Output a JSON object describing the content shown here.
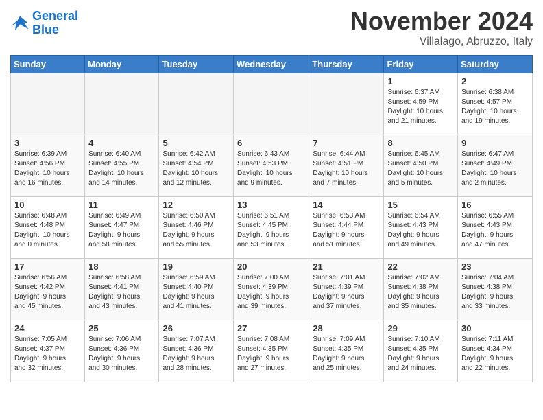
{
  "header": {
    "logo_line1": "General",
    "logo_line2": "Blue",
    "month": "November 2024",
    "location": "Villalago, Abruzzo, Italy"
  },
  "weekdays": [
    "Sunday",
    "Monday",
    "Tuesday",
    "Wednesday",
    "Thursday",
    "Friday",
    "Saturday"
  ],
  "weeks": [
    [
      {
        "day": "",
        "info": ""
      },
      {
        "day": "",
        "info": ""
      },
      {
        "day": "",
        "info": ""
      },
      {
        "day": "",
        "info": ""
      },
      {
        "day": "",
        "info": ""
      },
      {
        "day": "1",
        "info": "Sunrise: 6:37 AM\nSunset: 4:59 PM\nDaylight: 10 hours\nand 21 minutes."
      },
      {
        "day": "2",
        "info": "Sunrise: 6:38 AM\nSunset: 4:57 PM\nDaylight: 10 hours\nand 19 minutes."
      }
    ],
    [
      {
        "day": "3",
        "info": "Sunrise: 6:39 AM\nSunset: 4:56 PM\nDaylight: 10 hours\nand 16 minutes."
      },
      {
        "day": "4",
        "info": "Sunrise: 6:40 AM\nSunset: 4:55 PM\nDaylight: 10 hours\nand 14 minutes."
      },
      {
        "day": "5",
        "info": "Sunrise: 6:42 AM\nSunset: 4:54 PM\nDaylight: 10 hours\nand 12 minutes."
      },
      {
        "day": "6",
        "info": "Sunrise: 6:43 AM\nSunset: 4:53 PM\nDaylight: 10 hours\nand 9 minutes."
      },
      {
        "day": "7",
        "info": "Sunrise: 6:44 AM\nSunset: 4:51 PM\nDaylight: 10 hours\nand 7 minutes."
      },
      {
        "day": "8",
        "info": "Sunrise: 6:45 AM\nSunset: 4:50 PM\nDaylight: 10 hours\nand 5 minutes."
      },
      {
        "day": "9",
        "info": "Sunrise: 6:47 AM\nSunset: 4:49 PM\nDaylight: 10 hours\nand 2 minutes."
      }
    ],
    [
      {
        "day": "10",
        "info": "Sunrise: 6:48 AM\nSunset: 4:48 PM\nDaylight: 10 hours\nand 0 minutes."
      },
      {
        "day": "11",
        "info": "Sunrise: 6:49 AM\nSunset: 4:47 PM\nDaylight: 9 hours\nand 58 minutes."
      },
      {
        "day": "12",
        "info": "Sunrise: 6:50 AM\nSunset: 4:46 PM\nDaylight: 9 hours\nand 55 minutes."
      },
      {
        "day": "13",
        "info": "Sunrise: 6:51 AM\nSunset: 4:45 PM\nDaylight: 9 hours\nand 53 minutes."
      },
      {
        "day": "14",
        "info": "Sunrise: 6:53 AM\nSunset: 4:44 PM\nDaylight: 9 hours\nand 51 minutes."
      },
      {
        "day": "15",
        "info": "Sunrise: 6:54 AM\nSunset: 4:43 PM\nDaylight: 9 hours\nand 49 minutes."
      },
      {
        "day": "16",
        "info": "Sunrise: 6:55 AM\nSunset: 4:43 PM\nDaylight: 9 hours\nand 47 minutes."
      }
    ],
    [
      {
        "day": "17",
        "info": "Sunrise: 6:56 AM\nSunset: 4:42 PM\nDaylight: 9 hours\nand 45 minutes."
      },
      {
        "day": "18",
        "info": "Sunrise: 6:58 AM\nSunset: 4:41 PM\nDaylight: 9 hours\nand 43 minutes."
      },
      {
        "day": "19",
        "info": "Sunrise: 6:59 AM\nSunset: 4:40 PM\nDaylight: 9 hours\nand 41 minutes."
      },
      {
        "day": "20",
        "info": "Sunrise: 7:00 AM\nSunset: 4:39 PM\nDaylight: 9 hours\nand 39 minutes."
      },
      {
        "day": "21",
        "info": "Sunrise: 7:01 AM\nSunset: 4:39 PM\nDaylight: 9 hours\nand 37 minutes."
      },
      {
        "day": "22",
        "info": "Sunrise: 7:02 AM\nSunset: 4:38 PM\nDaylight: 9 hours\nand 35 minutes."
      },
      {
        "day": "23",
        "info": "Sunrise: 7:04 AM\nSunset: 4:38 PM\nDaylight: 9 hours\nand 33 minutes."
      }
    ],
    [
      {
        "day": "24",
        "info": "Sunrise: 7:05 AM\nSunset: 4:37 PM\nDaylight: 9 hours\nand 32 minutes."
      },
      {
        "day": "25",
        "info": "Sunrise: 7:06 AM\nSunset: 4:36 PM\nDaylight: 9 hours\nand 30 minutes."
      },
      {
        "day": "26",
        "info": "Sunrise: 7:07 AM\nSunset: 4:36 PM\nDaylight: 9 hours\nand 28 minutes."
      },
      {
        "day": "27",
        "info": "Sunrise: 7:08 AM\nSunset: 4:35 PM\nDaylight: 9 hours\nand 27 minutes."
      },
      {
        "day": "28",
        "info": "Sunrise: 7:09 AM\nSunset: 4:35 PM\nDaylight: 9 hours\nand 25 minutes."
      },
      {
        "day": "29",
        "info": "Sunrise: 7:10 AM\nSunset: 4:35 PM\nDaylight: 9 hours\nand 24 minutes."
      },
      {
        "day": "30",
        "info": "Sunrise: 7:11 AM\nSunset: 4:34 PM\nDaylight: 9 hours\nand 22 minutes."
      }
    ]
  ]
}
